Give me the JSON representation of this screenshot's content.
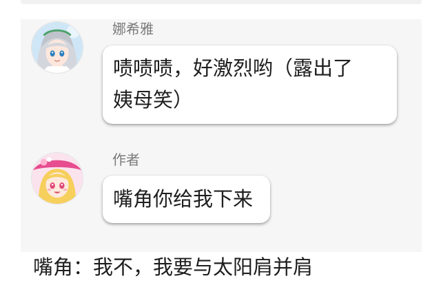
{
  "messages": [
    {
      "sender": "娜希雅",
      "avatar_icon": "silver-hair-girl-avatar",
      "lines": [
        "啧啧啧，好激烈哟（露出了",
        "姨母笑）"
      ]
    },
    {
      "sender": "作者",
      "avatar_icon": "blonde-girl-pink-hat-avatar",
      "lines": [
        "嘴角你给我下来"
      ]
    }
  ],
  "caption": "嘴角：我不，我要与太阳肩并肩",
  "colors": {
    "background": "#ffffff",
    "chat_panel": "#f6f6f6",
    "bubble": "#ffffff",
    "sender_text": "#7a7a7a",
    "message_text": "#1e1e1e"
  }
}
